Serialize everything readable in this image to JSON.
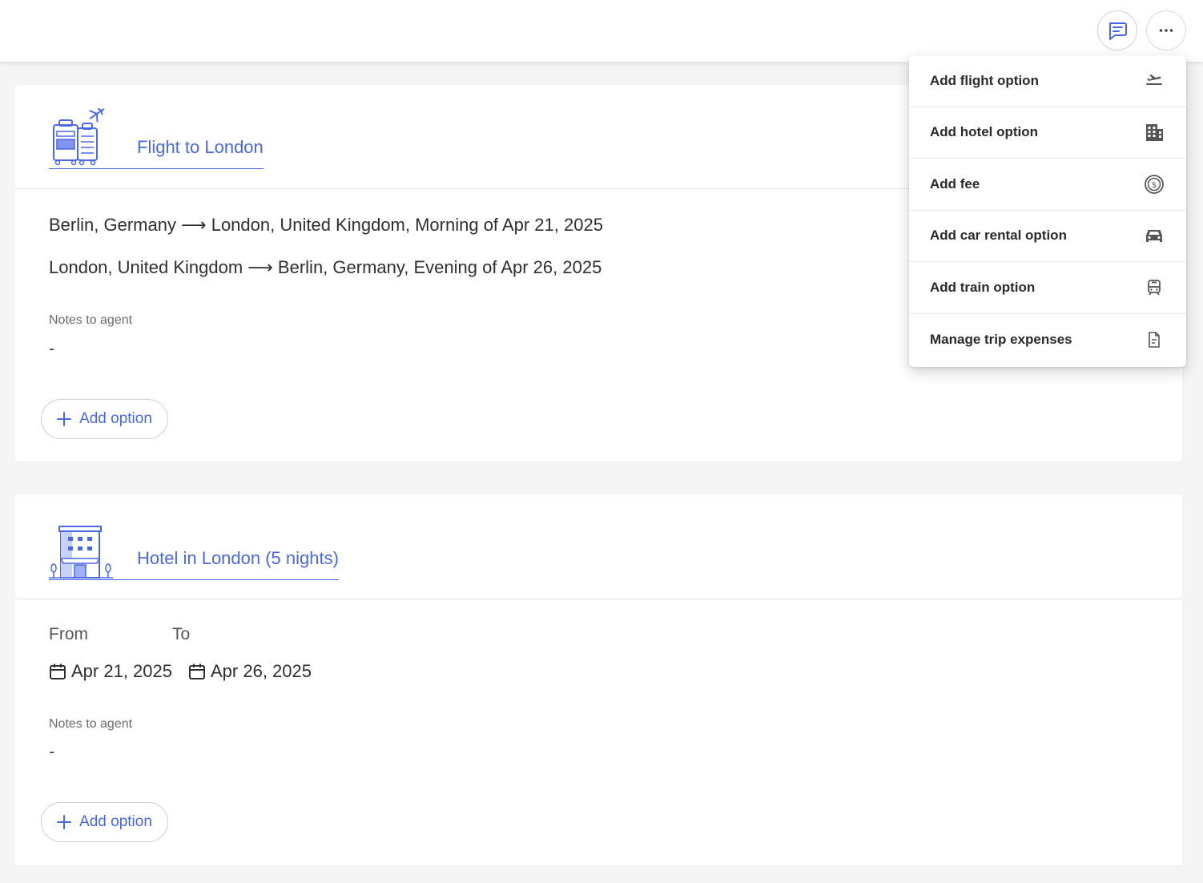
{
  "header": {
    "chat_icon": "chat-icon",
    "more_icon": "more-horizontal-icon"
  },
  "colors": {
    "accent": "#4a67e6",
    "text": "#2f2f2f",
    "muted": "#6b6b6b",
    "background": "#f5f5f5"
  },
  "flight_card": {
    "title": "Flight to London",
    "illustration": "luggage-plane-illustration",
    "routes": [
      "Berlin, Germany ⟶ London, United Kingdom, Morning of Apr 21, 2025",
      "London, United Kingdom ⟶ Berlin, Germany, Evening of Apr 26, 2025"
    ],
    "notes_label": "Notes to agent",
    "notes_value": "-",
    "add_option_label": "Add option"
  },
  "hotel_card": {
    "title": "Hotel in London (5 nights)",
    "illustration": "hotel-building-illustration",
    "from_label": "From",
    "to_label": "To",
    "from_date": "Apr 21, 2025",
    "to_date": "Apr 26, 2025",
    "calendar_icon": "calendar-icon",
    "notes_label": "Notes to agent",
    "notes_value": "-",
    "add_option_label": "Add option"
  },
  "menu": {
    "items": [
      {
        "label": "Add flight option",
        "icon": "flight-takeoff-icon"
      },
      {
        "label": "Add hotel option",
        "icon": "building-icon"
      },
      {
        "label": "Add fee",
        "icon": "dollar-coin-icon"
      },
      {
        "label": "Add car rental option",
        "icon": "car-icon"
      },
      {
        "label": "Add train option",
        "icon": "train-icon"
      },
      {
        "label": "Manage trip expenses",
        "icon": "document-icon"
      }
    ]
  }
}
